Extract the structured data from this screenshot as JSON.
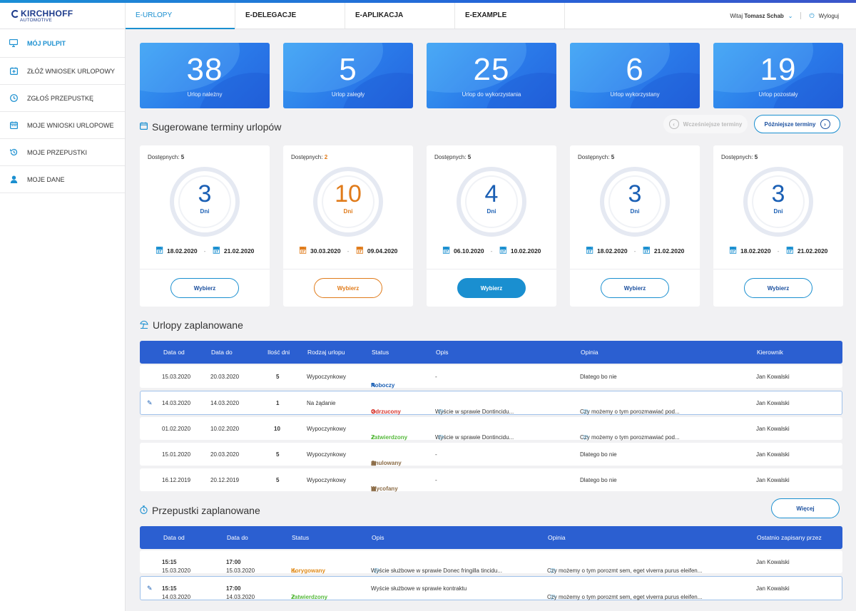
{
  "brand": {
    "name": "KIRCHHOFF",
    "sub": "AUTOMOTIVE"
  },
  "tabs": [
    {
      "label": "E-URLOPY"
    },
    {
      "label": "E-DELEGACJE"
    },
    {
      "label": "E-APLIKACJA"
    },
    {
      "label": "E-EXAMPLE"
    }
  ],
  "user": {
    "greeting": "Witaj",
    "name": "Tomasz Schab",
    "logout": "Wyloguj"
  },
  "sidebar": {
    "items": [
      {
        "label": "MÓJ PULPIT",
        "icon": "monitor-icon"
      },
      {
        "label": "ZŁÓŻ WNIOSEK URLOPOWY",
        "icon": "calendar-plus-icon"
      },
      {
        "label": "ZGŁOŚ PRZEPUSTKĘ",
        "icon": "clock-icon"
      },
      {
        "label": "MOJE WNIOSKI URLOPOWE",
        "icon": "calendar-icon"
      },
      {
        "label": "MOJE PRZEPUSTKI",
        "icon": "history-icon"
      },
      {
        "label": "MOJE DANE",
        "icon": "user-icon"
      }
    ]
  },
  "stats": [
    {
      "value": "38",
      "label": "Urlop należny"
    },
    {
      "value": "5",
      "label": "Urlop zaległy"
    },
    {
      "value": "25",
      "label": "Urlop do wykorzystania"
    },
    {
      "value": "6",
      "label": "Urlop wykorzystany"
    },
    {
      "value": "19",
      "label": "Urlop pozostały"
    }
  ],
  "suggested": {
    "title": "Sugerowane terminy urlopów",
    "earlier": "Wcześniejsze terminy",
    "later": "Późniejsze terminy",
    "available_label": "Dostępnych:",
    "days_label": "Dni",
    "select_label": "Wybierz",
    "cards": [
      {
        "available": "5",
        "days": "3",
        "from": "18.02.2020",
        "to": "21.02.2020"
      },
      {
        "available": "2",
        "days": "10",
        "from": "30.03.2020",
        "to": "09.04.2020"
      },
      {
        "available": "5",
        "days": "4",
        "from": "06.10.2020",
        "to": "10.02.2020"
      },
      {
        "available": "5",
        "days": "3",
        "from": "18.02.2020",
        "to": "21.02.2020"
      },
      {
        "available": "5",
        "days": "3",
        "from": "18.02.2020",
        "to": "21.02.2020"
      }
    ]
  },
  "planned": {
    "title": "Urlopy zaplanowane",
    "headers": [
      "Data od",
      "Data do",
      "Ilość dni",
      "Rodzaj urlopu",
      "Status",
      "Opis",
      "Opinia",
      "Kierownik"
    ],
    "rows": [
      {
        "from": "15.03.2020",
        "to": "20.03.2020",
        "days": "5",
        "type": "Wypoczynkowy",
        "status": "Roboczy",
        "desc": "-",
        "opinion": "Dlatego bo nie",
        "manager": "Jan Kowalski"
      },
      {
        "from": "14.03.2020",
        "to": "14.03.2020",
        "days": "1",
        "type": "Na żądanie",
        "status": "Odrzucony",
        "desc": "Wyście w sprawie Dontincidu...",
        "opinion": "Czy możemy o tym porozmawiać pod...",
        "manager": "Jan Kowalski"
      },
      {
        "from": "01.02.2020",
        "to": "10.02.2020",
        "days": "10",
        "type": "Wypoczynkowy",
        "status": "Zatwierdzony",
        "desc": "Wyście w sprawie Dontincidu...",
        "opinion": "Czy możemy o tym porozmawiać pod...",
        "manager": "Jan Kowalski"
      },
      {
        "from": "15.01.2020",
        "to": "20.03.2020",
        "days": "5",
        "type": "Wypoczynkowy",
        "status": "Anulowany",
        "desc": "-",
        "opinion": "Dlatego bo nie",
        "manager": "Jan Kowalski"
      },
      {
        "from": "16.12.2019",
        "to": "20.12.2019",
        "days": "5",
        "type": "Wypoczynkowy",
        "status": "Wycofany",
        "desc": "-",
        "opinion": "Dlatego bo nie",
        "manager": "Jan Kowalski"
      }
    ]
  },
  "passes": {
    "title": "Przepustki zaplanowane",
    "more": "Więcej",
    "headers": [
      "Data od",
      "Data do",
      "Status",
      "Opis",
      "Opinia",
      "Ostatnio zapisany przez"
    ],
    "rows": [
      {
        "from_date": "15.03.2020",
        "from_time": "15:15",
        "to_date": "15.03.2020",
        "to_time": "17:00",
        "status": "Korygowany",
        "desc": "Wyście służbowe w sprawie Donec fringilla tincidu...",
        "opinion": "Czy możemy o tym porozmt sem, eget viverra purus eleifen...",
        "saved_by": "Jan Kowalski"
      },
      {
        "from_date": "14.03.2020",
        "from_time": "15:15",
        "to_date": "14.03.2020",
        "to_time": "17:00",
        "status": "Zatwierdzony",
        "desc": "Wyście służbowe w sprawie kontraktu",
        "opinion": "Czy możemy o tym porozmt sem, eget viverra purus eleifen...",
        "saved_by": "Jan Kowalski"
      }
    ]
  },
  "colors": {
    "accent": "#1a8fd0",
    "header_blue": "#2b5fd1",
    "orange": "#e07b1a",
    "red": "#d6332b",
    "green": "#56b93c"
  }
}
